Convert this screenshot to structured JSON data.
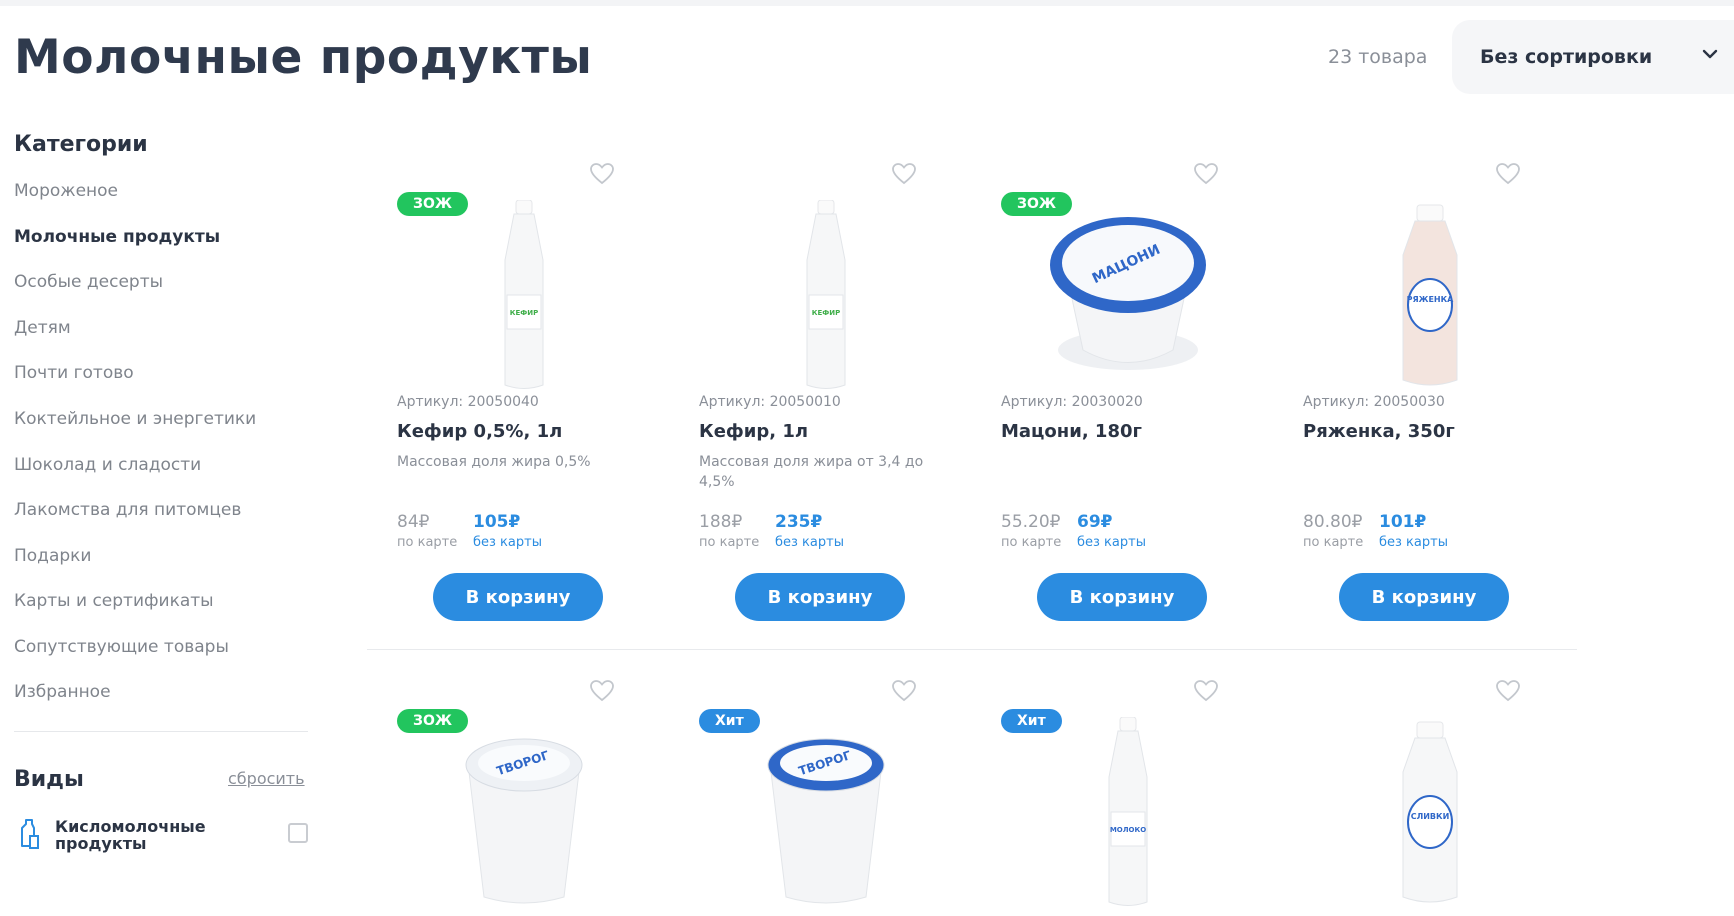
{
  "header": {
    "title": "Молочные продукты",
    "count": "23 товара",
    "sort_label": "Без сортировки"
  },
  "sidebar": {
    "categories_title": "Категории",
    "categories": [
      "Мороженое",
      "Молочные продукты",
      "Особые десерты",
      "Детям",
      "Почти готово",
      "Коктейльное и энергетики",
      "Шоколад и сладости",
      "Лакомства для питомцев",
      "Подарки",
      "Карты и сертификаты",
      "Сопутствующие товары",
      "Избранное"
    ],
    "active_category": "Молочные продукты",
    "types_title": "Виды",
    "reset_label": "сбросить",
    "type_option": "Кисломолочные продукты"
  },
  "products": [
    {
      "badge": "ЗОЖ",
      "sku": "Артикул: 20050040",
      "name": "Кефир 0,5%, 1л",
      "desc": "Массовая доля жира 0,5%",
      "price_card": "84₽",
      "price_card_label": "по карте",
      "price_nocard": "105₽",
      "price_nocard_label": "без карты",
      "button": "В корзину",
      "image_label": "КЕФИР"
    },
    {
      "badge": "",
      "sku": "Артикул: 20050010",
      "name": "Кефир, 1л",
      "desc": "Массовая доля жира от 3,4 до 4,5%",
      "price_card": "188₽",
      "price_card_label": "по карте",
      "price_nocard": "235₽",
      "price_nocard_label": "без карты",
      "button": "В корзину",
      "image_label": "КЕФИР"
    },
    {
      "badge": "ЗОЖ",
      "sku": "Артикул: 20030020",
      "name": "Мацони, 180г",
      "desc": "",
      "price_card": "55.20₽",
      "price_card_label": "по карте",
      "price_nocard": "69₽",
      "price_nocard_label": "без карты",
      "button": "В корзину",
      "image_label": "МАЦОНИ"
    },
    {
      "badge": "",
      "sku": "Артикул: 20050030",
      "name": "Ряженка, 350г",
      "desc": "",
      "price_card": "80.80₽",
      "price_card_label": "по карте",
      "price_nocard": "101₽",
      "price_nocard_label": "без карты",
      "button": "В корзину",
      "image_label": "РЯЖЕНКА"
    },
    {
      "badge": "ЗОЖ",
      "image_label": "ТВОРОГ"
    },
    {
      "badge": "Хит",
      "image_label": "ТВОРОГ"
    },
    {
      "badge": "Хит",
      "image_label": "МОЛОКО"
    },
    {
      "badge": "",
      "image_label": "СЛИВКИ"
    }
  ],
  "colors": {
    "accent": "#2b8ce0",
    "badge_zoj": "#22c55e",
    "badge_hit": "#2b8ce0",
    "text_dark": "#2b3444",
    "text_muted": "#8a8f98"
  }
}
